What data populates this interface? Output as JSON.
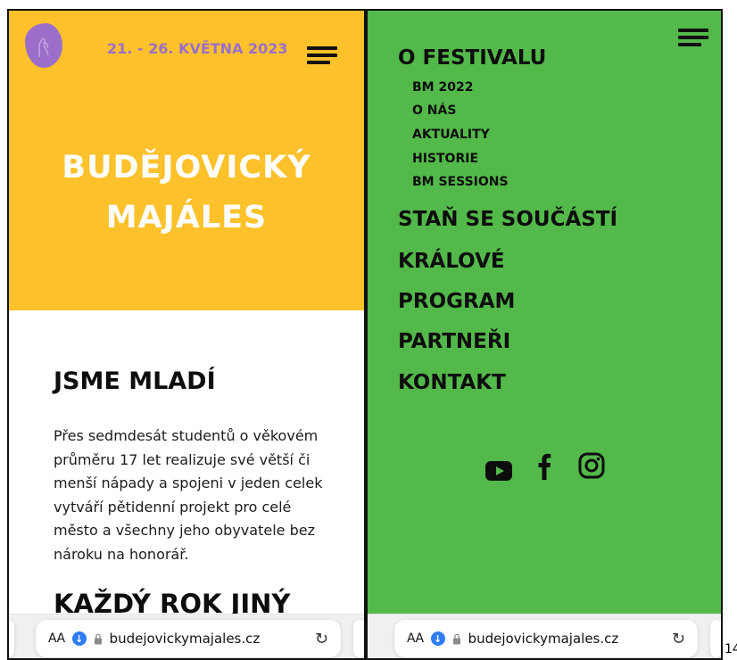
{
  "left_screen": {
    "dates": "21. - 26. KVĚTNA 2023",
    "hero_title_line1": "BUDĚJOVICKÝ",
    "hero_title_line2": "MAJÁLES",
    "heading1": "JSME MLADÍ",
    "paragraph": "Přes sedmdesát studentů o věkovém průměru 17 let realizuje své větší či menší nápady a spojeni v jeden celek vytváří pětidenní projekt pro celé město a všechny jeho obyvatele bez nároku na honorář.",
    "heading2": "KAŽDÝ ROK JINÝ"
  },
  "right_screen": {
    "menu": {
      "o_festivalu": "O FESTIVALU",
      "sub": [
        "BM 2022",
        "O NÁS",
        "AKTUALITY",
        "HISTORIE",
        "BM SESSIONS"
      ],
      "stan_se": "STAŇ SE SOUČÁSTÍ",
      "kralove": "KRÁLOVÉ",
      "program": "PROGRAM",
      "partneri": "PARTNEŘI",
      "kontakt": "KONTAKT"
    },
    "social_icons": [
      "youtube-icon",
      "facebook-icon",
      "instagram-icon"
    ]
  },
  "browser": {
    "aa_label": "AA",
    "url": "budejovickymajales.cz"
  },
  "page_number": "14",
  "colors": {
    "hero_yellow": "#fcc12b",
    "menu_green": "#53b94a",
    "logo_purple": "#9b6fc9"
  }
}
